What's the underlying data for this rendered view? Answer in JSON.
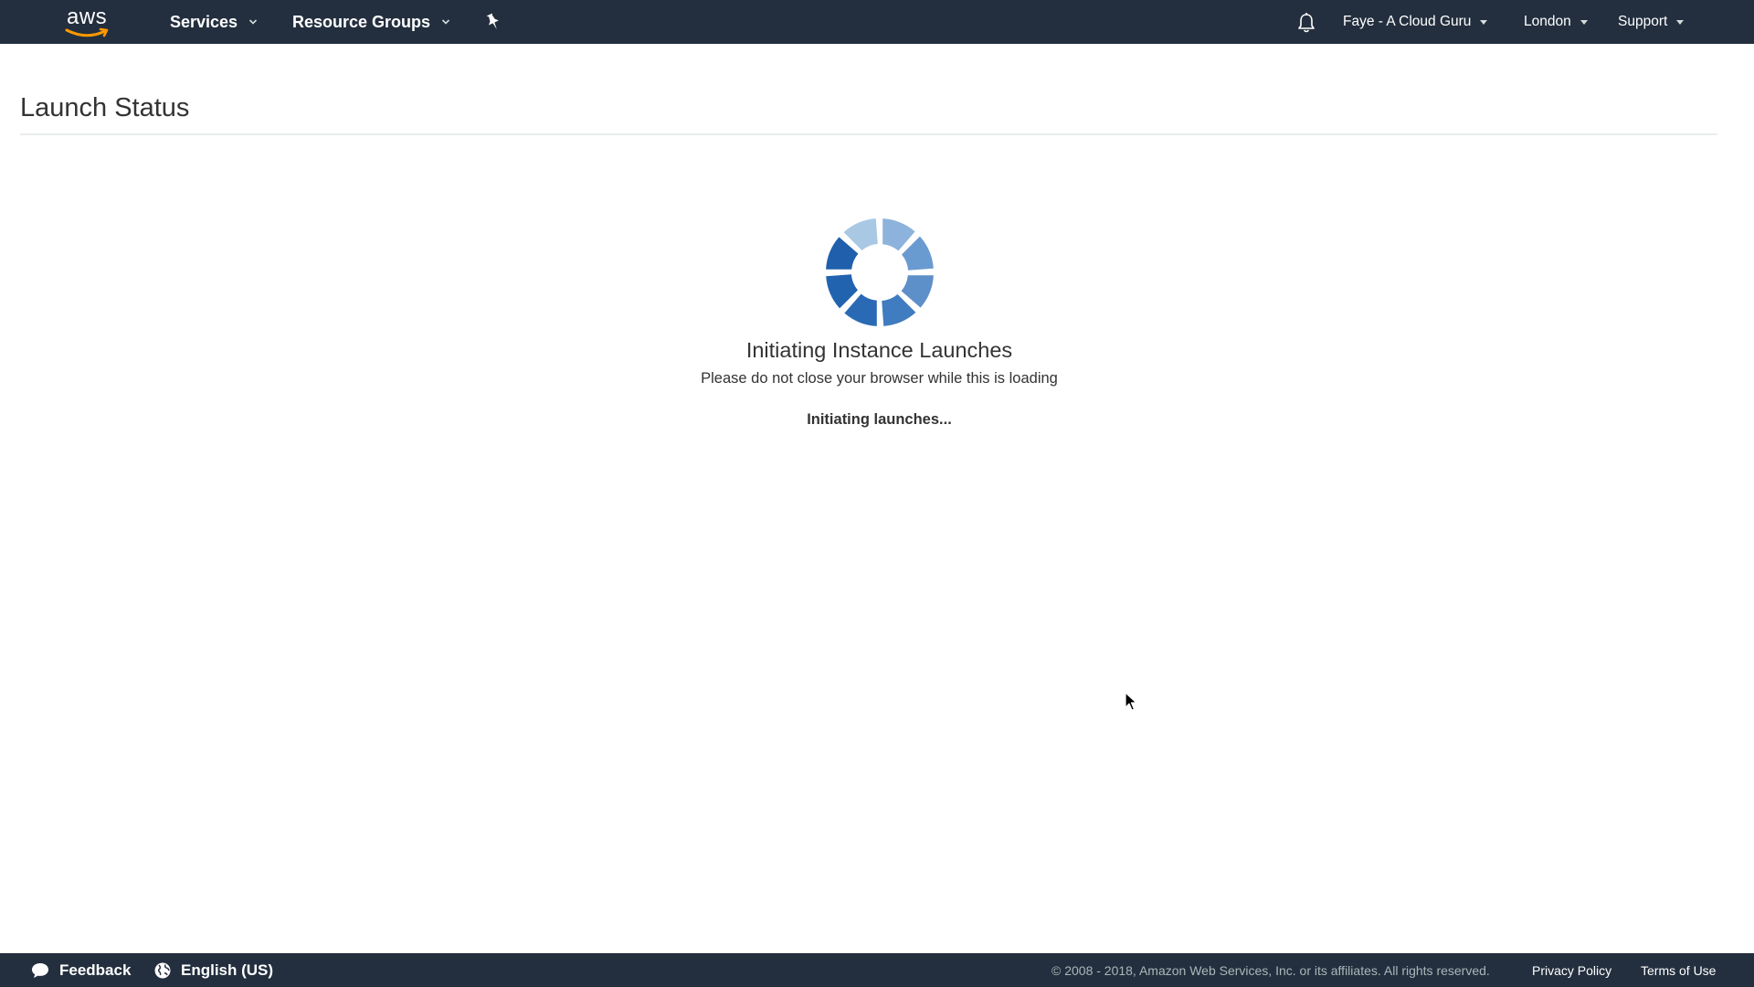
{
  "topbar": {
    "logo_text": "aws",
    "services_label": "Services",
    "resource_groups_label": "Resource Groups",
    "account_label": "Faye - A Cloud Guru",
    "region_label": "London",
    "support_label": "Support"
  },
  "page": {
    "title": "Launch Status"
  },
  "status": {
    "heading": "Initiating Instance Launches",
    "subtext": "Please do not close your browser while this is loading",
    "progress": "Initiating launches..."
  },
  "footer": {
    "feedback_label": "Feedback",
    "language_label": "English (US)",
    "copyright": "© 2008 - 2018, Amazon Web Services, Inc. or its affiliates. All rights reserved.",
    "privacy_label": "Privacy Policy",
    "terms_label": "Terms of Use"
  },
  "colors": {
    "nav_background": "#232f3e",
    "spinner_dark": "#1f5fab",
    "spinner_mid": "#4a86c8",
    "spinner_light": "#a9c8e4",
    "logo_smile": "#ff9900"
  },
  "icons": [
    "pin-icon",
    "bell-icon",
    "chevron-down-icon",
    "caret-down-icon",
    "speech-bubble-icon",
    "globe-icon",
    "loading-spinner-icon",
    "mouse-pointer-icon"
  ]
}
